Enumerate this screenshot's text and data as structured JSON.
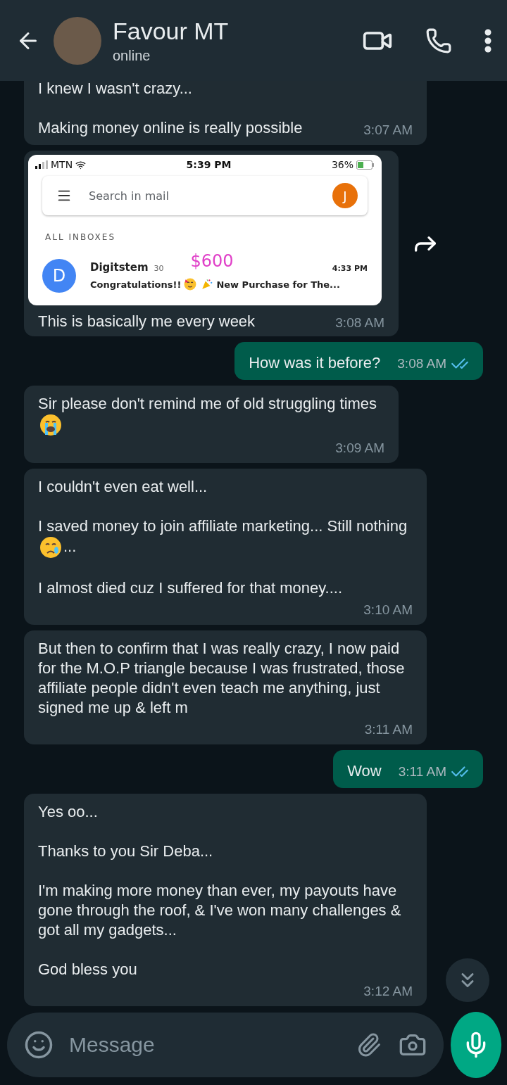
{
  "header": {
    "name": "Favour MT",
    "status": "online"
  },
  "messages": [
    {
      "kind": "text",
      "outgoing": false,
      "paragraphs": [
        [
          {
            "kind": "text",
            "text": "I knew I wasn't crazy..."
          }
        ],
        [
          {
            "kind": "text",
            "text": "Making money online is really possible"
          }
        ]
      ],
      "time": "3:07 AM"
    },
    {
      "kind": "image",
      "outgoing": false,
      "forward": true,
      "caption": "This is basically me every week",
      "time": "3:08 AM",
      "shot": {
        "carrier": "MTN",
        "clock": "5:39 PM",
        "battery": "36%",
        "search_placeholder": "Search in mail",
        "account_initial": "J",
        "section": "ALL INBOXES",
        "amount": "$600",
        "email": {
          "initial": "D",
          "sender": "Digitstem",
          "count": "30",
          "time": "4:33 PM",
          "subject": [
            {
              "kind": "text",
              "text": "Congratulations!!"
            },
            {
              "kind": "partying"
            },
            {
              "kind": "confetti"
            },
            {
              "kind": "text",
              "text": "New Purchase for The..."
            }
          ]
        }
      }
    },
    {
      "kind": "text",
      "outgoing": true,
      "read": true,
      "paragraphs": [
        [
          {
            "kind": "text",
            "text": "How was it before?"
          }
        ]
      ],
      "time": "3:08 AM"
    },
    {
      "kind": "text",
      "outgoing": false,
      "paragraphs": [
        [
          {
            "kind": "text",
            "text": "Sir please don't remind me of old struggling times"
          },
          {
            "kind": "sobbing"
          }
        ]
      ],
      "time": "3:09 AM"
    },
    {
      "kind": "text",
      "outgoing": false,
      "paragraphs": [
        [
          {
            "kind": "text",
            "text": "I couldn't even eat well..."
          }
        ],
        [
          {
            "kind": "text",
            "text": "I saved money to join affiliate marketing... Still nothing"
          },
          {
            "kind": "crying"
          },
          {
            "kind": "text",
            "text": "..."
          }
        ],
        [
          {
            "kind": "text",
            "text": "I almost died cuz I suffered for that money...."
          }
        ]
      ],
      "time": "3:10 AM"
    },
    {
      "kind": "text",
      "outgoing": false,
      "paragraphs": [
        [
          {
            "kind": "text",
            "text": "But then to confirm that I was really crazy, I now paid for the M.O.P triangle because I was frustrated, those affiliate people didn't even teach me anything, just signed me up & left m"
          }
        ]
      ],
      "time": "3:11 AM"
    },
    {
      "kind": "text",
      "outgoing": true,
      "read": true,
      "paragraphs": [
        [
          {
            "kind": "text",
            "text": "Wow"
          }
        ]
      ],
      "time": "3:11 AM"
    },
    {
      "kind": "text",
      "outgoing": false,
      "paragraphs": [
        [
          {
            "kind": "text",
            "text": "Yes oo..."
          }
        ],
        [
          {
            "kind": "text",
            "text": "Thanks to you Sir Deba..."
          }
        ],
        [
          {
            "kind": "text",
            "text": "I'm making more money than ever, my payouts have gone through the roof, & I've won many challenges & got all my gadgets..."
          }
        ],
        [
          {
            "kind": "text",
            "text": "God bless you"
          }
        ]
      ],
      "time": "3:12 AM"
    }
  ],
  "composer": {
    "placeholder": "Message"
  }
}
